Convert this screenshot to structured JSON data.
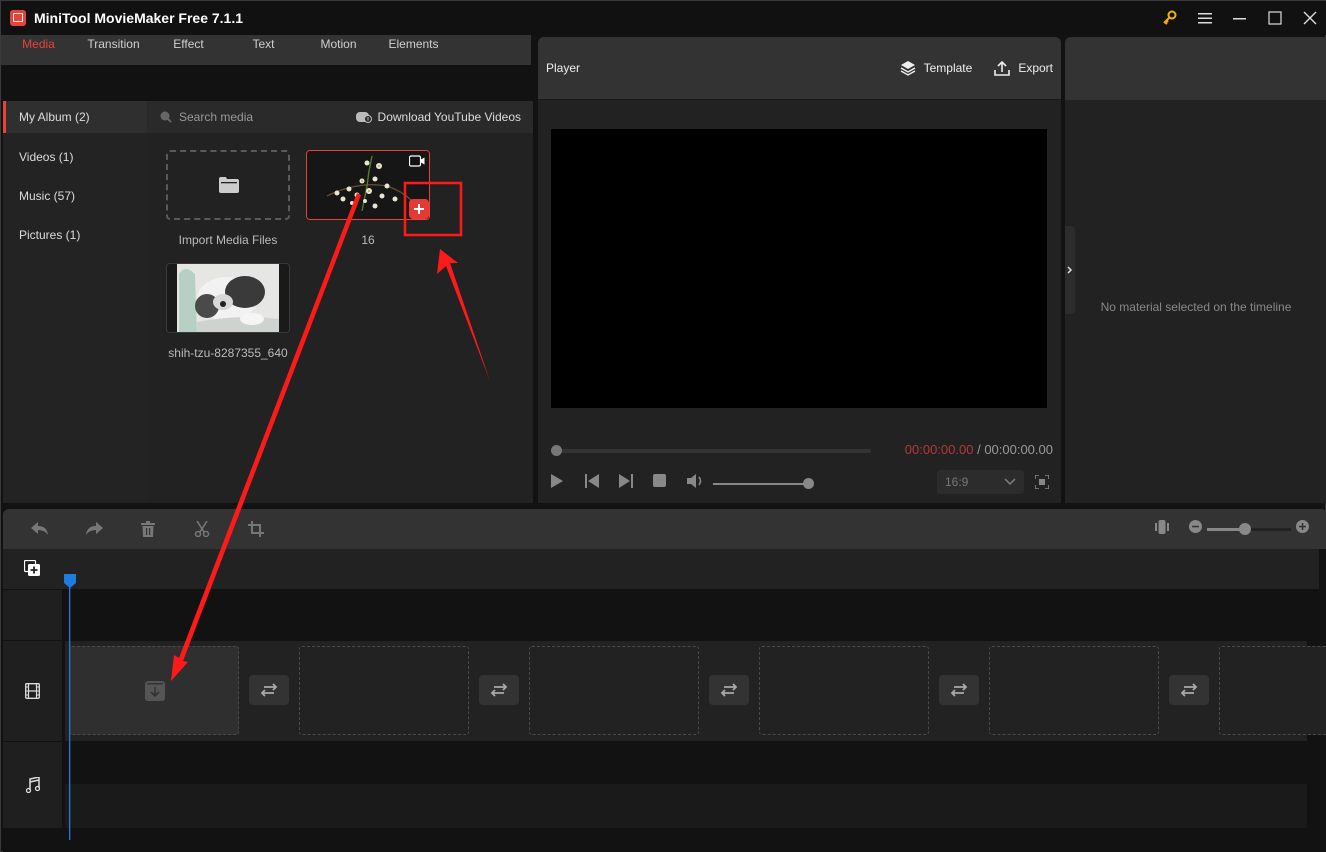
{
  "app": {
    "title": "MiniTool MovieMaker Free 7.1.1",
    "window_controls": [
      "key-icon",
      "menu-icon",
      "minimize-icon",
      "maximize-icon",
      "close-icon"
    ]
  },
  "toolbar": {
    "tabs": [
      {
        "label": "Media",
        "icon": "folder-icon",
        "active": true
      },
      {
        "label": "Transition",
        "icon": "swap-icon",
        "active": false
      },
      {
        "label": "Effect",
        "icon": "effect-icon",
        "active": false
      },
      {
        "label": "Text",
        "icon": "text-icon",
        "active": false
      },
      {
        "label": "Motion",
        "icon": "motion-icon",
        "active": false
      },
      {
        "label": "Elements",
        "icon": "elements-icon",
        "active": false
      }
    ]
  },
  "album": {
    "items": [
      {
        "label": "My Album (2)",
        "active": true
      },
      {
        "label": "Videos (1)",
        "active": false
      },
      {
        "label": "Music (57)",
        "active": false
      },
      {
        "label": "Pictures (1)",
        "active": false
      }
    ]
  },
  "media": {
    "search_placeholder": "Search media",
    "download_label": "Download YouTube Videos",
    "import_label": "Import Media Files",
    "items": [
      {
        "label": "16",
        "type": "video",
        "selected": true
      },
      {
        "label": "shih-tzu-8287355_640",
        "type": "image",
        "selected": false
      }
    ]
  },
  "player": {
    "title": "Player",
    "template_label": "Template",
    "export_label": "Export",
    "current_time": "00:00:00.00",
    "separator": " / ",
    "total_time": "00:00:00.00",
    "aspect_ratio": "16:9",
    "progress": 0,
    "volume": 1.0
  },
  "properties": {
    "empty_message": "No material selected on the timeline"
  },
  "timeline": {
    "zoom_level": 0.45,
    "slot_count": 6
  },
  "colors": {
    "accent": "#e8423b",
    "playhead": "#1e7be0",
    "annotation": "#ff1a1a",
    "time_current": "#b33a35"
  }
}
